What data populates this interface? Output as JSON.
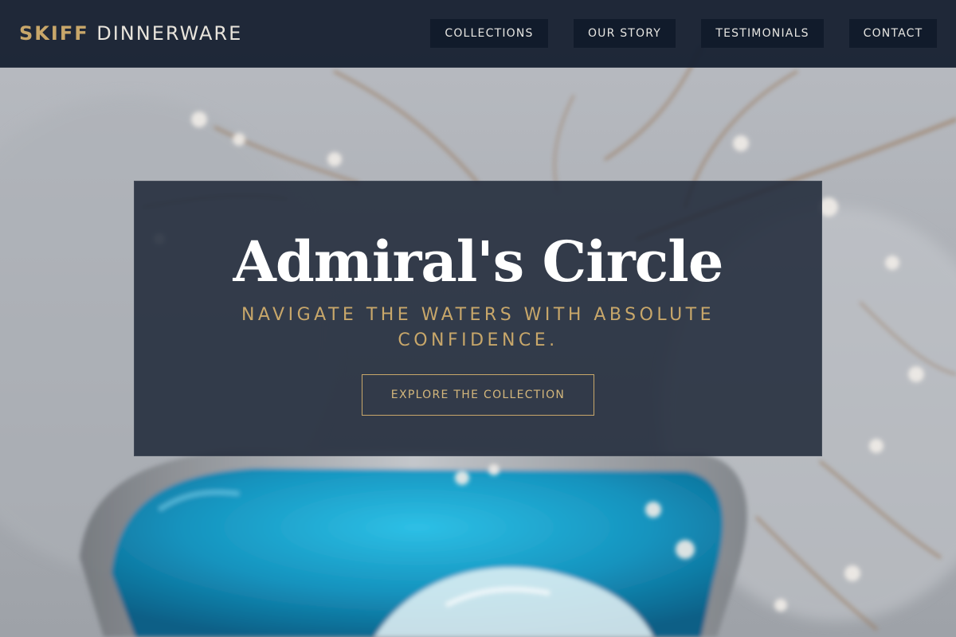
{
  "header": {
    "brand_accent": "SKIFF",
    "brand_rest": "DINNERWARE",
    "nav": [
      {
        "label": "COLLECTIONS"
      },
      {
        "label": "OUR STORY"
      },
      {
        "label": "TESTIMONIALS"
      },
      {
        "label": "CONTACT"
      }
    ]
  },
  "hero": {
    "title": "Admiral's Circle",
    "subtitle": "NAVIGATE THE WATERS WITH ABSOLUTE CONFIDENCE.",
    "cta_label": "EXPLORE THE COLLECTION"
  },
  "colors": {
    "header_bg": "#162030",
    "nav_button_bg": "#111b2b",
    "accent_gold": "#c8a76a",
    "hero_card_bg": "#1e2838",
    "bowl_glaze": "#1aa3c9"
  }
}
